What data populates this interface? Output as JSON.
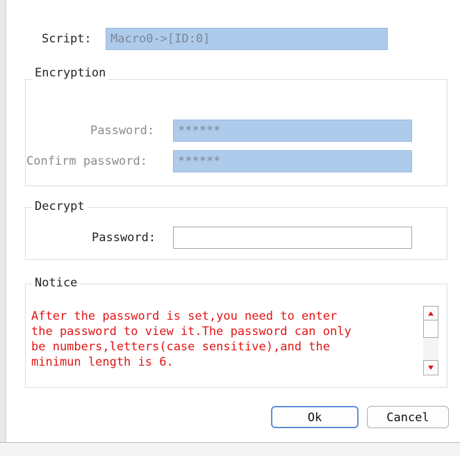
{
  "script": {
    "label": "Script:",
    "value": "Macro0->[ID:0]"
  },
  "encryption": {
    "title": "Encryption",
    "password_label": "Password:",
    "password_value": "******",
    "confirm_label": "Confirm password:",
    "confirm_value": "******"
  },
  "decrypt": {
    "title": "Decrypt",
    "password_label": "Password:",
    "password_value": ""
  },
  "notice": {
    "title": "Notice",
    "text": "After the password is set,you need to enter\nthe password to view it.The password can only\nbe numbers,letters(case sensitive),and the\nminimun length is 6."
  },
  "buttons": {
    "ok": "Ok",
    "cancel": "Cancel"
  },
  "colors": {
    "readonly_field": "#aecbec",
    "notice_text": "#e11414",
    "default_button_border": "#5b8fd8"
  }
}
